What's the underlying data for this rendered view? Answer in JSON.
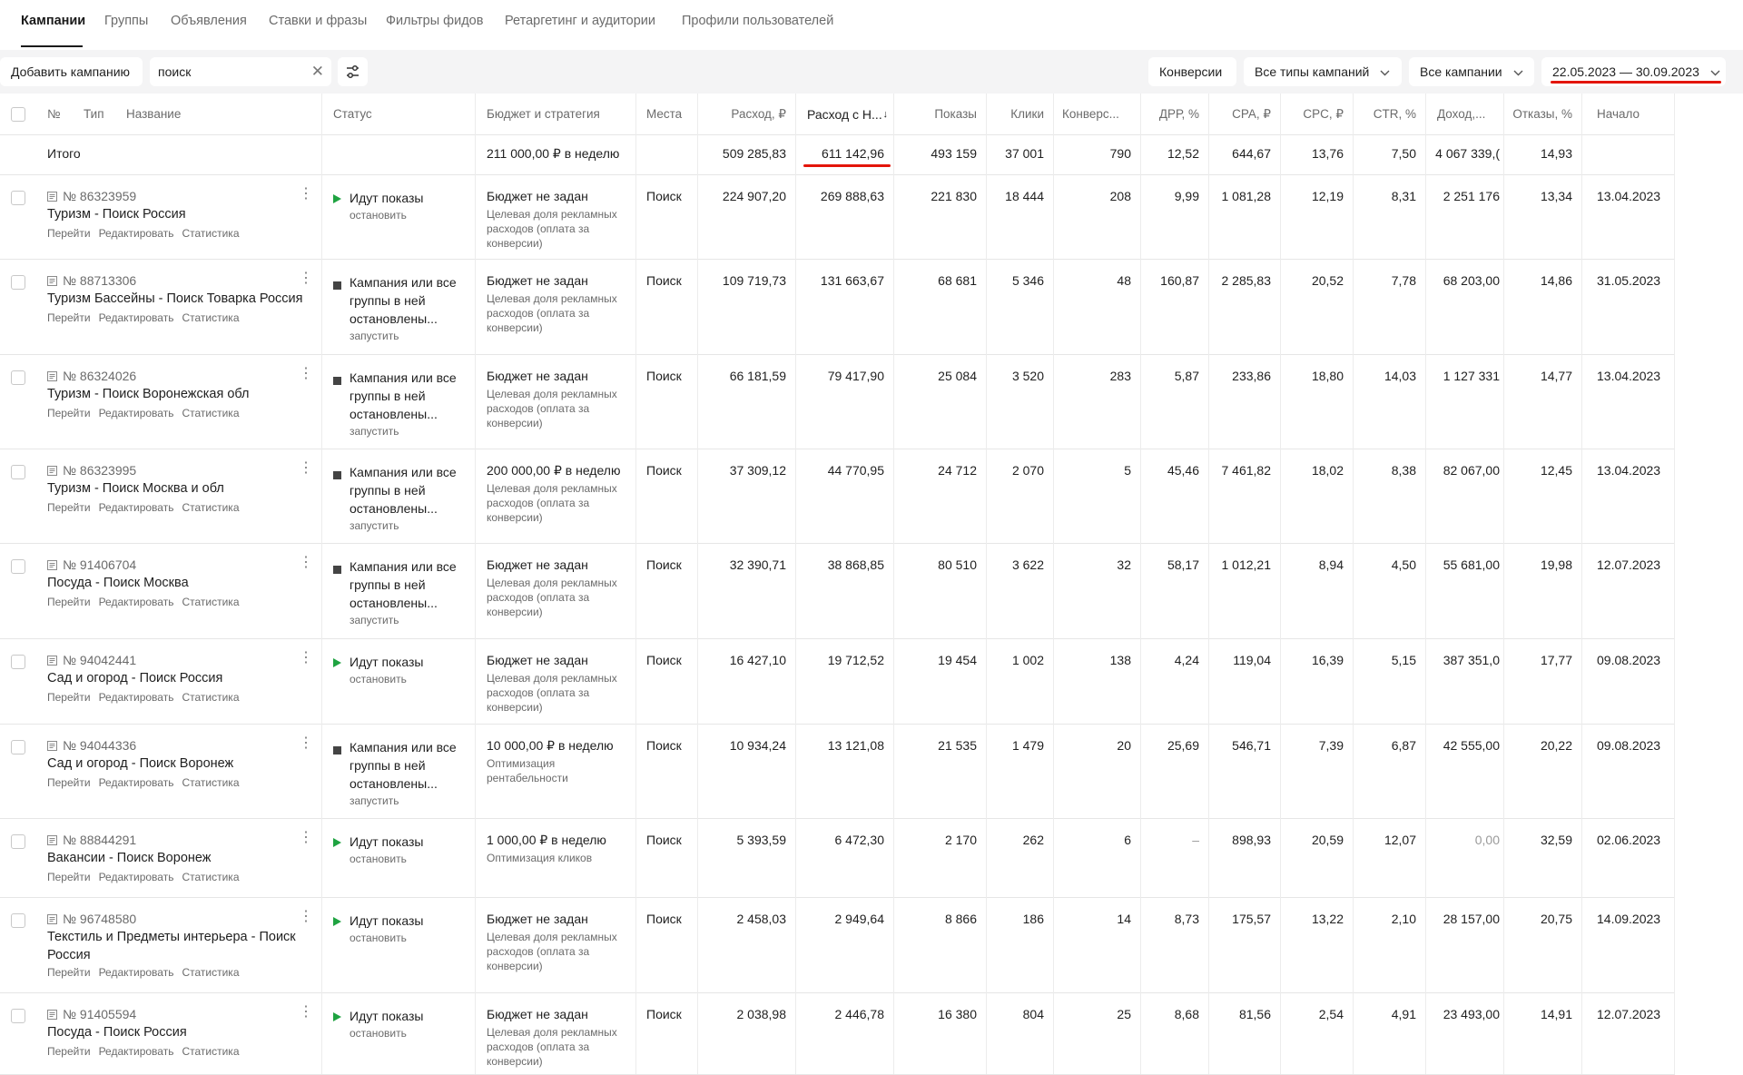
{
  "tabs": [
    {
      "label": "Кампании",
      "active": true
    },
    {
      "label": "Группы",
      "active": false
    },
    {
      "label": "Объявления",
      "active": false
    },
    {
      "label": "Ставки и фразы",
      "active": false
    },
    {
      "label": "Фильтры фидов",
      "active": false
    },
    {
      "label": "Ретаргетинг и аудитории",
      "active": false
    },
    {
      "label": "Профили пользователей",
      "active": false
    }
  ],
  "toolbar": {
    "add_campaign_label": "Добавить кампанию",
    "search_value": "поиск",
    "conversions_label": "Конверсии",
    "campaign_types_label": "Все типы кампаний",
    "all_campaigns_label": "Все кампании",
    "date_range": "22.05.2023 — 30.09.2023"
  },
  "accent_red": "#e3150a",
  "table": {
    "headers": {
      "num": "№",
      "type": "Тип",
      "name": "Название",
      "status": "Статус",
      "budget": "Бюджет и стратегия",
      "places": "Места",
      "spend": "Расход, ₽",
      "spend_vat": "Расход с Н...",
      "spend_vat_sort": "↓",
      "impressions": "Показы",
      "clicks": "Клики",
      "conversions": "Конверс...",
      "drr": "ДРР, %",
      "cpa": "CPA, ₽",
      "cpc": "CPC, ₽",
      "ctr": "CTR, %",
      "income": "Доход,...",
      "bounces": "Отказы, %",
      "start": "Начало"
    },
    "total": {
      "label": "Итого",
      "budget": "211 000,00 ₽ в неделю",
      "spend": "509 285,83",
      "spend_vat": "611 142,96",
      "impressions": "493 159",
      "clicks": "37 001",
      "conversions": "790",
      "drr": "12,52",
      "cpa": "644,67",
      "cpc": "13,76",
      "ctr": "7,50",
      "income": "4 067 339,(",
      "bounces": "14,93"
    },
    "row_links": {
      "go": "Перейти",
      "edit": "Редактировать",
      "stats": "Статистика"
    },
    "rows": [
      {
        "id": "№ 86323959",
        "name": "Туризм - Поиск Россия",
        "status_type": "running",
        "status": "Идут показы",
        "status_action": "остановить",
        "budget": "Бюджет не задан",
        "strategy": "Целевая доля рекламных расходов (оплата за конверсии)",
        "place": "Поиск",
        "spend": "224 907,20",
        "spend_vat": "269 888,63",
        "impressions": "221 830",
        "clicks": "18 444",
        "conversions": "208",
        "drr": "9,99",
        "cpa": "1 081,28",
        "cpc": "12,19",
        "ctr": "8,31",
        "income": "2 251 176",
        "bounces": "13,34",
        "start": "13.04.2023"
      },
      {
        "id": "№ 88713306",
        "name": "Туризм Бассейны - Поиск Товарка Россия",
        "status_type": "stopped",
        "status": "Кампания или все группы в ней остановлены...",
        "status_action": "запустить",
        "budget": "Бюджет не задан",
        "strategy": "Целевая доля рекламных расходов (оплата за конверсии)",
        "place": "Поиск",
        "spend": "109 719,73",
        "spend_vat": "131 663,67",
        "impressions": "68 681",
        "clicks": "5 346",
        "conversions": "48",
        "drr": "160,87",
        "cpa": "2 285,83",
        "cpc": "20,52",
        "ctr": "7,78",
        "income": "68 203,00",
        "bounces": "14,86",
        "start": "31.05.2023"
      },
      {
        "id": "№ 86324026",
        "name": "Туризм - Поиск Воронежская обл",
        "status_type": "stopped",
        "status": "Кампания или все группы в ней остановлены...",
        "status_action": "запустить",
        "budget": "Бюджет не задан",
        "strategy": "Целевая доля рекламных расходов (оплата за конверсии)",
        "place": "Поиск",
        "spend": "66 181,59",
        "spend_vat": "79 417,90",
        "impressions": "25 084",
        "clicks": "3 520",
        "conversions": "283",
        "drr": "5,87",
        "cpa": "233,86",
        "cpc": "18,80",
        "ctr": "14,03",
        "income": "1 127 331",
        "bounces": "14,77",
        "start": "13.04.2023"
      },
      {
        "id": "№ 86323995",
        "name": "Туризм - Поиск Москва и обл",
        "status_type": "stopped",
        "status": "Кампания или все группы в ней остановлены...",
        "status_action": "запустить",
        "budget": "200 000,00 ₽ в неделю",
        "strategy": "Целевая доля рекламных расходов (оплата за конверсии)",
        "place": "Поиск",
        "spend": "37 309,12",
        "spend_vat": "44 770,95",
        "impressions": "24 712",
        "clicks": "2 070",
        "conversions": "5",
        "drr": "45,46",
        "cpa": "7 461,82",
        "cpc": "18,02",
        "ctr": "8,38",
        "income": "82 067,00",
        "bounces": "12,45",
        "start": "13.04.2023"
      },
      {
        "id": "№ 91406704",
        "name": "Посуда - Поиск Москва",
        "status_type": "stopped",
        "status": "Кампания или все группы в ней остановлены...",
        "status_action": "запустить",
        "budget": "Бюджет не задан",
        "strategy": "Целевая доля рекламных расходов (оплата за конверсии)",
        "place": "Поиск",
        "spend": "32 390,71",
        "spend_vat": "38 868,85",
        "impressions": "80 510",
        "clicks": "3 622",
        "conversions": "32",
        "drr": "58,17",
        "cpa": "1 012,21",
        "cpc": "8,94",
        "ctr": "4,50",
        "income": "55 681,00",
        "bounces": "19,98",
        "start": "12.07.2023"
      },
      {
        "id": "№ 94042441",
        "name": "Сад и огород - Поиск Россия",
        "status_type": "running",
        "status": "Идут показы",
        "status_action": "остановить",
        "budget": "Бюджет не задан",
        "strategy": "Целевая доля рекламных расходов (оплата за конверсии)",
        "place": "Поиск",
        "spend": "16 427,10",
        "spend_vat": "19 712,52",
        "impressions": "19 454",
        "clicks": "1 002",
        "conversions": "138",
        "drr": "4,24",
        "cpa": "119,04",
        "cpc": "16,39",
        "ctr": "5,15",
        "income": "387 351,0",
        "bounces": "17,77",
        "start": "09.08.2023"
      },
      {
        "id": "№ 94044336",
        "name": "Сад и огород - Поиск Воронеж",
        "status_type": "stopped",
        "status": "Кампания или все группы в ней остановлены...",
        "status_action": "запустить",
        "budget": "10 000,00 ₽ в неделю",
        "strategy": "Оптимизация рентабельности",
        "place": "Поиск",
        "spend": "10 934,24",
        "spend_vat": "13 121,08",
        "impressions": "21 535",
        "clicks": "1 479",
        "conversions": "20",
        "drr": "25,69",
        "cpa": "546,71",
        "cpc": "7,39",
        "ctr": "6,87",
        "income": "42 555,00",
        "bounces": "20,22",
        "start": "09.08.2023"
      },
      {
        "id": "№ 88844291",
        "name": "Вакансии - Поиск Воронеж",
        "status_type": "running",
        "status": "Идут показы",
        "status_action": "остановить",
        "budget": "1 000,00 ₽ в неделю",
        "strategy": "Оптимизация кликов",
        "place": "Поиск",
        "spend": "5 393,59",
        "spend_vat": "6 472,30",
        "impressions": "2 170",
        "clicks": "262",
        "conversions": "6",
        "drr": "–",
        "cpa": "898,93",
        "cpc": "20,59",
        "ctr": "12,07",
        "income": "0,00",
        "bounces": "32,59",
        "start": "02.06.2023"
      },
      {
        "id": "№ 96748580",
        "name": "Текстиль и Предметы интерьера - Поиск Россия",
        "status_type": "running",
        "status": "Идут показы",
        "status_action": "остановить",
        "budget": "Бюджет не задан",
        "strategy": "Целевая доля рекламных расходов (оплата за конверсии)",
        "place": "Поиск",
        "spend": "2 458,03",
        "spend_vat": "2 949,64",
        "impressions": "8 866",
        "clicks": "186",
        "conversions": "14",
        "drr": "8,73",
        "cpa": "175,57",
        "cpc": "13,22",
        "ctr": "2,10",
        "income": "28 157,00",
        "bounces": "20,75",
        "start": "14.09.2023"
      },
      {
        "id": "№ 91405594",
        "name": "Посуда - Поиск Россия",
        "status_type": "running",
        "status": "Идут показы",
        "status_action": "остановить",
        "budget": "Бюджет не задан",
        "strategy": "Целевая доля рекламных расходов (оплата за конверсии)",
        "place": "Поиск",
        "spend": "2 038,98",
        "spend_vat": "2 446,78",
        "impressions": "16 380",
        "clicks": "804",
        "conversions": "25",
        "drr": "8,68",
        "cpa": "81,56",
        "cpc": "2,54",
        "ctr": "4,91",
        "income": "23 493,00",
        "bounces": "14,91",
        "start": "12.07.2023"
      }
    ]
  }
}
